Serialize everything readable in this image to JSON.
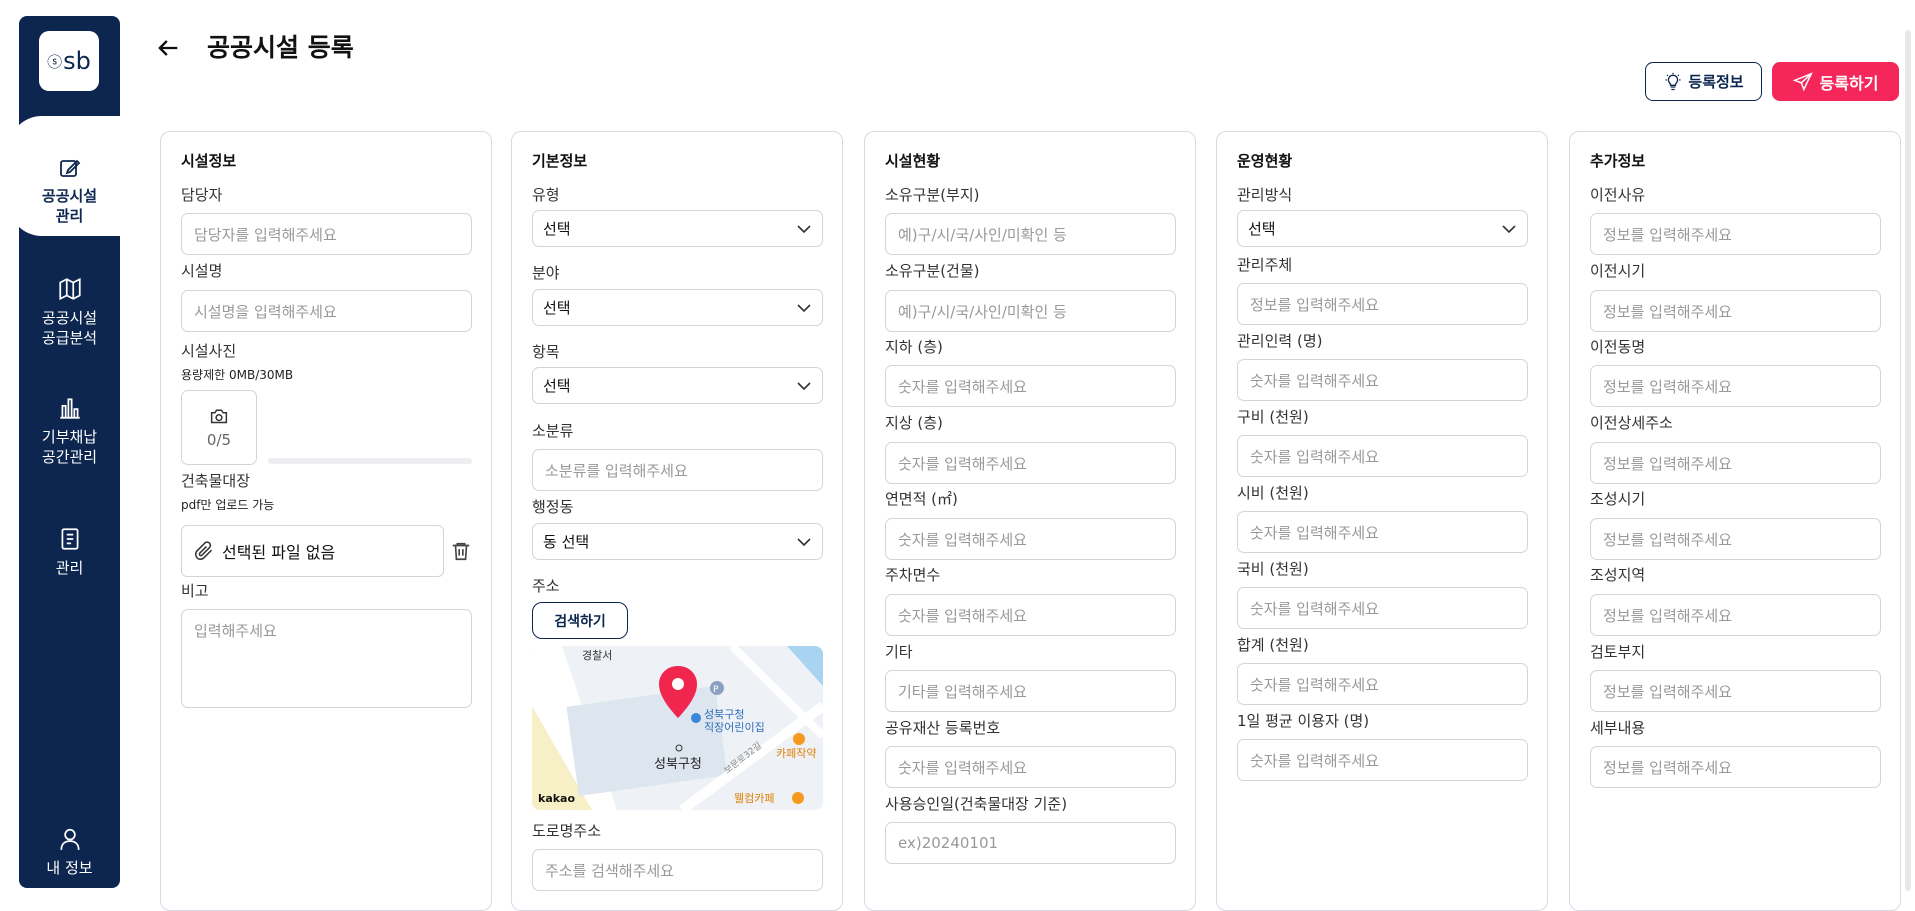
{
  "sidebar": {
    "logo_text": "sb",
    "items": [
      {
        "label_line1": "공공시설",
        "label_line2": "관리",
        "icon": "edit-icon",
        "active": true
      },
      {
        "label_line1": "공공시설",
        "label_line2": "공급분석",
        "icon": "map-icon",
        "active": false
      },
      {
        "label_line1": "기부채납",
        "label_line2": "공간관리",
        "icon": "bar-chart-icon",
        "active": false
      },
      {
        "label_line1": "관리",
        "label_line2": "",
        "icon": "clipboard-icon",
        "active": false
      }
    ],
    "profile_label": "내 정보"
  },
  "header": {
    "title": "공공시설 등록",
    "info_button": "등록정보",
    "submit_button": "등록하기"
  },
  "colors": {
    "navy": "#0d2650",
    "accent": "#f5265a"
  },
  "facility": {
    "title": "시설정보",
    "manager_label": "담당자",
    "manager_placeholder": "담당자를 입력해주세요",
    "name_label": "시설명",
    "name_placeholder": "시설명을 입력해주세요",
    "photo_label": "시설사진",
    "photo_limit": "용량제한 0MB/30MB",
    "photo_count": "0/5",
    "photo_usage_fraction": 0,
    "register_label": "건축물대장",
    "register_note": "pdf만 업로드 가능",
    "file_text": "선택된 파일 없음",
    "note_label": "비고",
    "note_placeholder": "입력해주세요"
  },
  "basic": {
    "title": "기본정보",
    "type_label": "유형",
    "type_value": "선택",
    "field_label": "분야",
    "field_value": "선택",
    "item_label": "항목",
    "item_value": "선택",
    "subclass_label": "소분류",
    "subclass_placeholder": "소분류를 입력해주세요",
    "district_label": "행정동",
    "district_value": "동 선택",
    "address_label": "주소",
    "search_button": "검색하기",
    "map": {
      "labels": [
        "경찰서",
        "성북구청",
        "직장어린이집",
        "카페작약",
        "성북구청",
        "웰컴카페",
        "보문로32길"
      ],
      "provider": "kakao"
    },
    "road_address_label": "도로명주소",
    "road_address_placeholder": "주소를 검색해주세요"
  },
  "status": {
    "title": "시설현황",
    "fields": [
      {
        "label": "소유구분(부지)",
        "placeholder": "예)구/시/국/사인/미확인 등"
      },
      {
        "label": "소유구분(건물)",
        "placeholder": "예)구/시/국/사인/미확인 등"
      },
      {
        "label": "지하 (층)",
        "placeholder": "숫자를 입력해주세요"
      },
      {
        "label": "지상 (층)",
        "placeholder": "숫자를 입력해주세요"
      },
      {
        "label": "연면적 (㎡)",
        "placeholder": "숫자를 입력해주세요"
      },
      {
        "label": "주차면수",
        "placeholder": "숫자를 입력해주세요"
      },
      {
        "label": "기타",
        "placeholder": "기타를 입력해주세요"
      },
      {
        "label": "공유재산 등록번호",
        "placeholder": "숫자를 입력해주세요"
      },
      {
        "label": "사용승인일(건축물대장 기준)",
        "placeholder": "ex)20240101"
      }
    ]
  },
  "operation": {
    "title": "운영현황",
    "method_label": "관리방식",
    "method_value": "선택",
    "fields": [
      {
        "label": "관리주체",
        "placeholder": "정보를 입력해주세요"
      },
      {
        "label": "관리인력 (명)",
        "placeholder": "숫자를 입력해주세요"
      },
      {
        "label": "구비 (천원)",
        "placeholder": "숫자를 입력해주세요"
      },
      {
        "label": "시비 (천원)",
        "placeholder": "숫자를 입력해주세요"
      },
      {
        "label": "국비 (천원)",
        "placeholder": "숫자를 입력해주세요"
      },
      {
        "label": "합계 (천원)",
        "placeholder": "숫자를 입력해주세요"
      },
      {
        "label": "1일 평균 이용자 (명)",
        "placeholder": "숫자를 입력해주세요"
      }
    ]
  },
  "extra": {
    "title": "추가정보",
    "fields": [
      {
        "label": "이전사유",
        "placeholder": "정보를 입력해주세요"
      },
      {
        "label": "이전시기",
        "placeholder": "정보를 입력해주세요"
      },
      {
        "label": "이전동명",
        "placeholder": "정보를 입력해주세요"
      },
      {
        "label": "이전상세주소",
        "placeholder": "정보를 입력해주세요"
      },
      {
        "label": "조성시기",
        "placeholder": "정보를 입력해주세요"
      },
      {
        "label": "조성지역",
        "placeholder": "정보를 입력해주세요"
      },
      {
        "label": "검토부지",
        "placeholder": "정보를 입력해주세요"
      },
      {
        "label": "세부내용",
        "placeholder": "정보를 입력해주세요"
      }
    ]
  }
}
